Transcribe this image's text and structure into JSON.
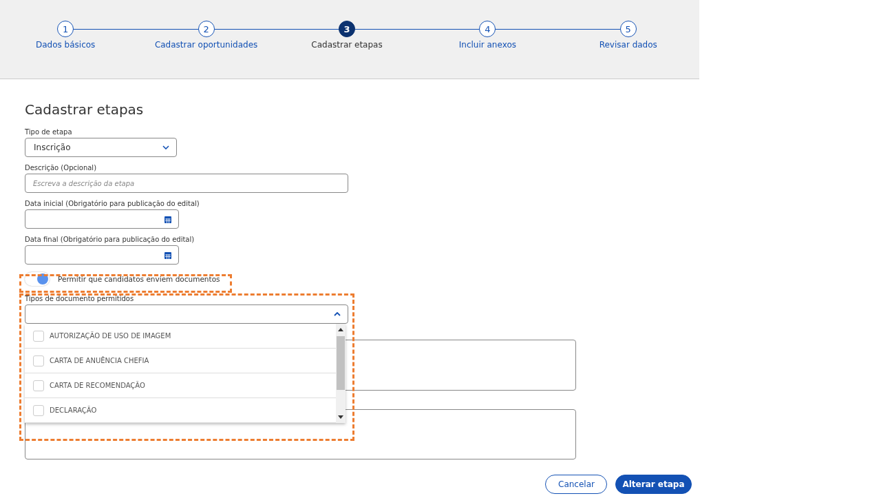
{
  "stepper": [
    {
      "number": "1",
      "label": "Dados básicos",
      "selected": false
    },
    {
      "number": "2",
      "label": "Cadastrar oportunidades",
      "selected": false
    },
    {
      "number": "3",
      "label": "Cadastrar etapas",
      "selected": true
    },
    {
      "number": "4",
      "label": "Incluir anexos",
      "selected": false
    },
    {
      "number": "5",
      "label": "Revisar dados",
      "selected": false
    }
  ],
  "title": "Cadastrar etapas",
  "stage_type": {
    "label": "Tipo de etapa",
    "value": "Inscrição"
  },
  "description": {
    "label": "Descrição (Opcional)",
    "placeholder": "Escreva a descrição da etapa"
  },
  "start_date": {
    "label": "Data inicial (Obrigatório para publicação do edital)"
  },
  "end_date": {
    "label": "Data final (Obrigatório para publicação do edital)"
  },
  "allow_documents": {
    "label": "Permitir que candidatos enviem documentos",
    "on": true
  },
  "document_types": {
    "label": "Tipos de documento permitidos",
    "expanded": true,
    "options": [
      {
        "label": "AUTORIZAÇÃO DE USO DE IMAGEM",
        "checked": false
      },
      {
        "label": "CARTA DE ANUÊNCIA CHEFIA",
        "checked": false
      },
      {
        "label": "CARTA DE RECOMENDAÇÃO",
        "checked": false
      },
      {
        "label": "DECLARAÇÃO",
        "checked": false
      }
    ]
  },
  "buttons": [
    {
      "label": "Cancelar",
      "kind": "secondary"
    },
    {
      "label": "Alterar etapa",
      "kind": "primary"
    }
  ]
}
